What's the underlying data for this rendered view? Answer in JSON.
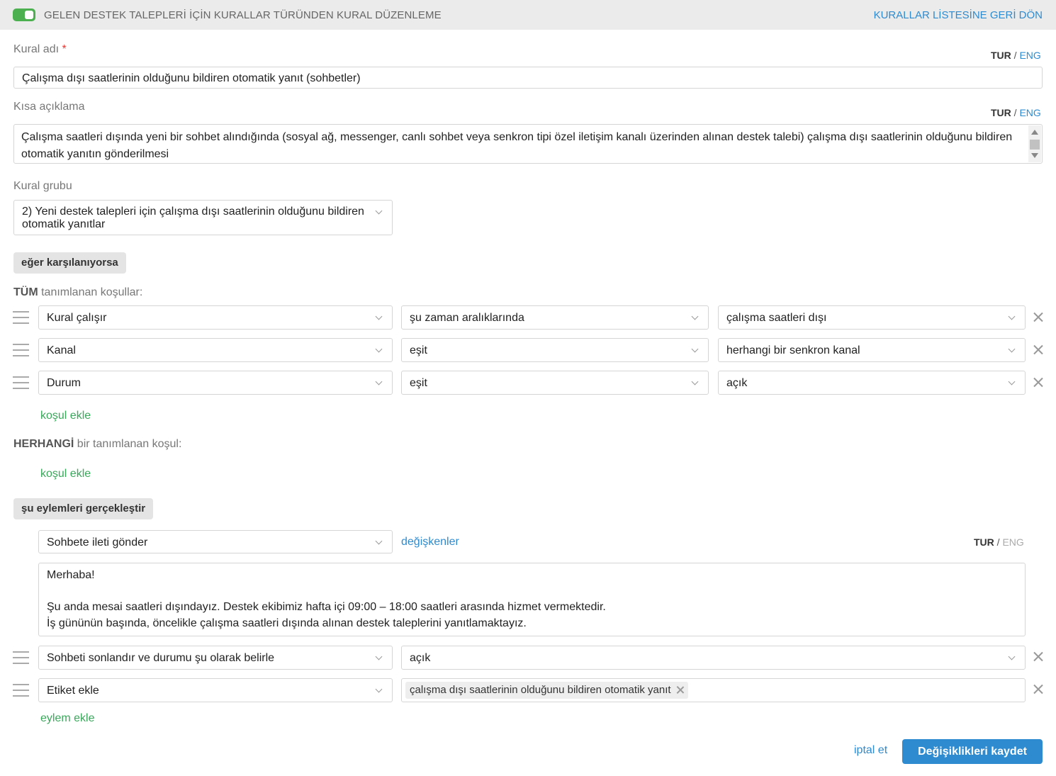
{
  "header": {
    "title": "GELEN DESTEK TALEPLERİ İÇİN KURALLAR TÜRÜNDEN KURAL DÜZENLEME",
    "back_link": "KURALLAR LİSTESİNE GERİ DÖN",
    "toggle_on": true
  },
  "lang": {
    "tur": "TUR",
    "sep": "/",
    "eng": "ENG"
  },
  "rule_name": {
    "label": "Kural adı",
    "required_mark": "*",
    "value": "Çalışma dışı saatlerinin olduğunu bildiren otomatik yanıt (sohbetler)"
  },
  "short_desc": {
    "label": "Kısa açıklama",
    "value": "Çalışma saatleri dışında yeni bir sohbet alındığında (sosyal ağ, messenger, canlı sohbet veya senkron tipi özel iletişim kanalı üzerinden alınan destek talebi) çalışma dışı saatlerinin olduğunu bildiren otomatik yanıtın gönderilmesi"
  },
  "rule_group": {
    "label": "Kural grubu",
    "line1": "2) Yeni destek talepleri için çalışma dışı saatlerinin olduğunu bildiren",
    "line2": "otomatik yanıtlar"
  },
  "if_section": {
    "pill": "eğer karşılanıyorsa",
    "all_title_bold": "TÜM",
    "all_title_rest": " tanımlanan koşullar:",
    "conditions": [
      {
        "field": "Kural çalışır",
        "operator": "şu zaman aralıklarında",
        "value": "çalışma saatleri dışı"
      },
      {
        "field": "Kanal",
        "operator": "eşit",
        "value": "herhangi bir senkron kanal"
      },
      {
        "field": "Durum",
        "operator": "eşit",
        "value": "açık"
      }
    ],
    "add_condition": "koşul ekle",
    "any_title_bold": "HERHANGİ",
    "any_title_rest": " bir tanımlanan koşul:",
    "add_condition_any": "koşul ekle"
  },
  "actions_section": {
    "pill": "şu eylemleri gerçekleştir",
    "action1": {
      "type": "Sohbete ileti gönder",
      "variables_link": "değişkenler",
      "message_lines": [
        "Merhaba!",
        "",
        "Şu anda mesai saatleri dışındayız. Destek ekibimiz hafta içi 09:00 – 18:00 saatleri arasında hizmet vermektedir.",
        "İş gününün başında, öncelikle çalışma saatleri dışında alınan destek taleplerini yanıtlamaktayız."
      ]
    },
    "action2": {
      "type": "Sohbeti sonlandır ve durumu şu olarak belirle",
      "value": "açık"
    },
    "action3": {
      "type": "Etiket ekle",
      "tag": "çalışma dışı saatlerinin olduğunu bildiren otomatik yanıt"
    },
    "add_action": "eylem ekle"
  },
  "footer": {
    "cancel": "iptal et",
    "save": "Değişiklikleri kaydet"
  },
  "colors": {
    "accent_blue": "#2e8bd0",
    "accent_green": "#3aa85b",
    "toggle_green": "#4caf50",
    "header_bg": "#ebebeb"
  }
}
